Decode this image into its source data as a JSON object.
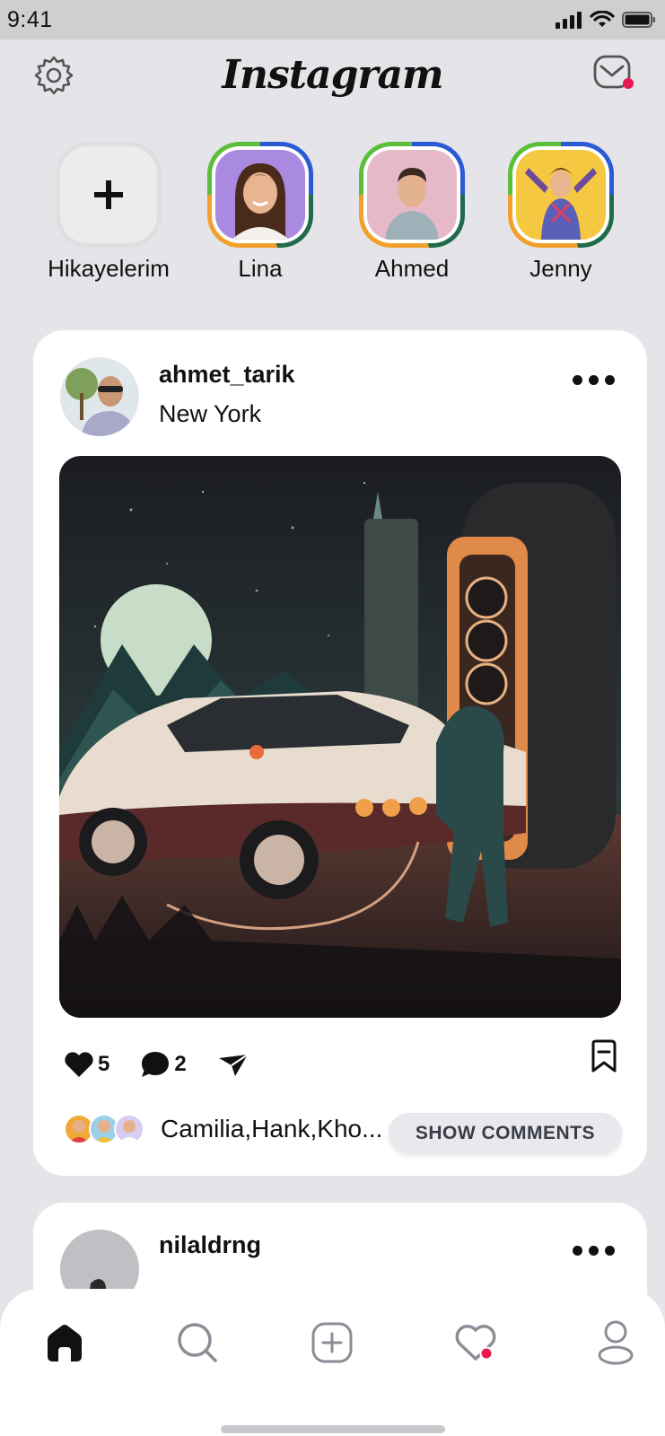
{
  "status_bar": {
    "time": "9:41"
  },
  "header": {
    "logo": "Instagram",
    "settings_icon": "gear-icon",
    "messages_icon": "mail-icon",
    "messages_badge_color": "#e8194f"
  },
  "stories": [
    {
      "name": "Hikayelerim",
      "type": "add"
    },
    {
      "name": "Lina",
      "type": "user"
    },
    {
      "name": "Ahmed",
      "type": "user"
    },
    {
      "name": "Jenny",
      "type": "user"
    }
  ],
  "post": {
    "username": "ahmet_tarik",
    "location": "New York",
    "likes": "5",
    "comments": "2",
    "liked_by": "Camilia,Hank,Kho...",
    "show_comments_label": "SHOW COMMENTS"
  },
  "post2": {
    "username": "nilaldrng"
  },
  "nav": {
    "items": [
      "home-icon",
      "search-icon",
      "add-post-icon",
      "heart-icon",
      "profile-icon"
    ],
    "active": "home-icon"
  },
  "colors": {
    "story_ring_1": "#f2a02b",
    "story_ring_2": "#5cbf3b",
    "story_ring_3": "#2a5ad4",
    "notification_dot": "#e8194f"
  }
}
